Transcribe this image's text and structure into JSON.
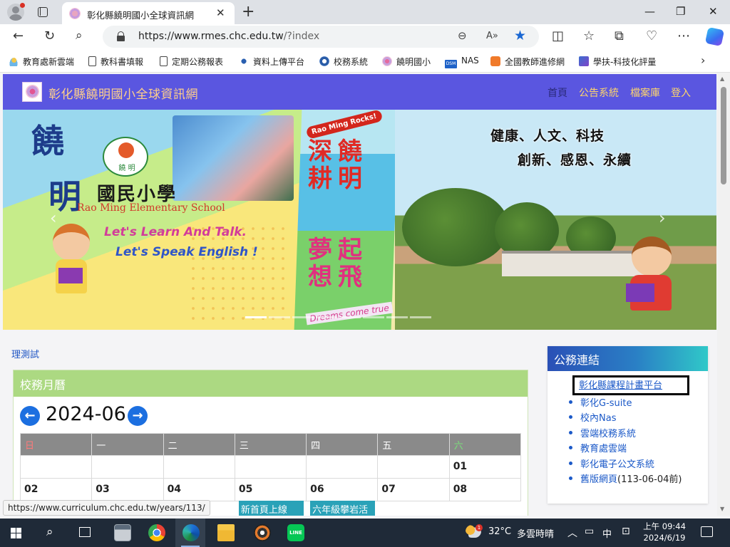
{
  "browser": {
    "tab_title": "彰化縣饒明國小全球資訊網",
    "tab_close": "✕",
    "new_tab": "+",
    "window_buttons": [
      "—",
      "❐",
      "✕"
    ],
    "url_host": "https://www.rmes.chc.edu.tw",
    "url_path": "/?index",
    "favorites": [
      {
        "label": "教育處新雲端",
        "icon": "cloud-icon"
      },
      {
        "label": "教科書填報",
        "icon": "page-icon"
      },
      {
        "label": "定期公務報表",
        "icon": "page-icon"
      },
      {
        "label": "資料上傳平台",
        "icon": "dot-icon"
      },
      {
        "label": "校務系統",
        "icon": "system-icon"
      },
      {
        "label": "饒明國小",
        "icon": "school-flower-icon"
      },
      {
        "label": "NAS",
        "icon": "nas-icon",
        "icon_text": "DSM"
      },
      {
        "label": "全國教師進修網",
        "icon": "orange-app-icon"
      },
      {
        "label": "學扶-科技化評量",
        "icon": "te-icon",
        "icon_text": "T"
      }
    ]
  },
  "site": {
    "title": "彰化縣饒明國小全球資訊網",
    "nav": [
      "首頁",
      "公告系統",
      "檔案庫",
      "登入"
    ],
    "active_nav": 0
  },
  "banner": {
    "big_char_1": "饒",
    "big_char_2": "明",
    "school_name_zh": "國民小學",
    "school_name_en": "Rao Ming Elementary School",
    "logo_text": "饒  明",
    "slogan_en_1": "Let's Learn And Talk.",
    "slogan_en_2": "Let's Speak English !",
    "rocks": "Rao Ming Rocks!",
    "vertical_1": "深耕",
    "vertical_2": "饒明",
    "vertical_3": "夢想",
    "vertical_4": "起飛",
    "dreams": "Dreams come true",
    "motto_1": "健康、人文、科技",
    "motto_2": "創新、感恩、永續",
    "slide_count": 8,
    "active_slide": 0
  },
  "cut_link": "理測試",
  "calendar": {
    "title": "校務月曆",
    "month": "2024-06",
    "weekdays": [
      "日",
      "一",
      "二",
      "三",
      "四",
      "五",
      "六"
    ],
    "rows": [
      [
        "",
        "",
        "",
        "",
        "",
        "",
        "01"
      ],
      [
        "02",
        "03",
        "04",
        "05",
        "06",
        "07",
        "08"
      ]
    ],
    "events": [
      {
        "day": "05",
        "label": "新首頁上線"
      },
      {
        "day": "06",
        "label": "六年級攀岩活"
      }
    ]
  },
  "links_panel": {
    "title": "公務連結",
    "items": [
      {
        "label": "彰化縣課程計畫平台",
        "note": ""
      },
      {
        "label": "彰化G-suite",
        "note": ""
      },
      {
        "label": "校內Nas",
        "note": ""
      },
      {
        "label": "雲端校務系統",
        "note": ""
      },
      {
        "label": "教育處雲端",
        "note": ""
      },
      {
        "label": "彰化電子公文系統",
        "note": ""
      },
      {
        "label": "舊版網頁",
        "note": "(113-06-04前)"
      }
    ],
    "focused_index": 0
  },
  "status_bar_url": "https://www.curriculum.chc.edu.tw/years/113/",
  "taskbar": {
    "weather_badge": "1",
    "temperature": "32°C",
    "weather_text": "多雲時晴",
    "ime": "中",
    "time": "上午 09:44",
    "date": "2024/6/19",
    "line_icon_text": "LINE"
  }
}
